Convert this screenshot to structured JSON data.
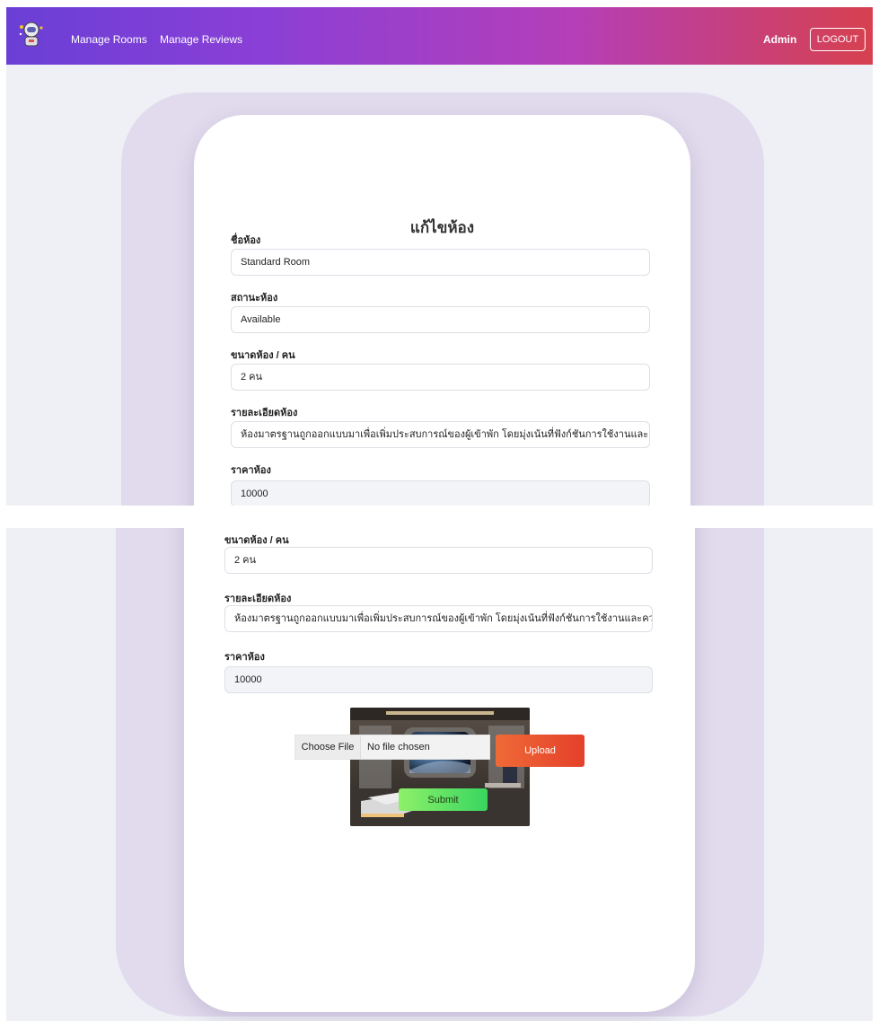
{
  "nav": {
    "links": [
      "Manage Rooms",
      "Manage Reviews"
    ],
    "user": "Admin",
    "logout_label": "LOGOUT",
    "logo_icon": "astronaut-icon"
  },
  "form": {
    "title": "แก้ไขห้อง",
    "fields": {
      "name": {
        "label": "ชื่อห้อง",
        "value": "Standard Room"
      },
      "status": {
        "label": "สถานะห้อง",
        "value": "Available"
      },
      "size": {
        "label": "ขนาดห้อง / คน",
        "value": "2 คน"
      },
      "detail": {
        "label": "รายละเอียดห้อง",
        "value": "ห้องมาตรฐานถูกออกแบบมาเพื่อเพิ่มประสบการณ์ของผู้เข้าพัก โดยมุ่งเน้นที่ฟังก์ชันการใช้งานและความสะดวก"
      },
      "price": {
        "label": "ราคาห้อง",
        "value": "10000"
      }
    },
    "file": {
      "choose_label": "Choose File",
      "status": "No file chosen"
    },
    "upload_label": "Upload",
    "submit_label": "Submit",
    "image_icon": "room-photo-icon"
  },
  "colors": {
    "nav_gradient": [
      "#6a3fd6",
      "#b43fb8",
      "#d6404f"
    ],
    "upload": "#e4402a",
    "submit": "#39d660",
    "backdrop": "#e2dbed"
  }
}
